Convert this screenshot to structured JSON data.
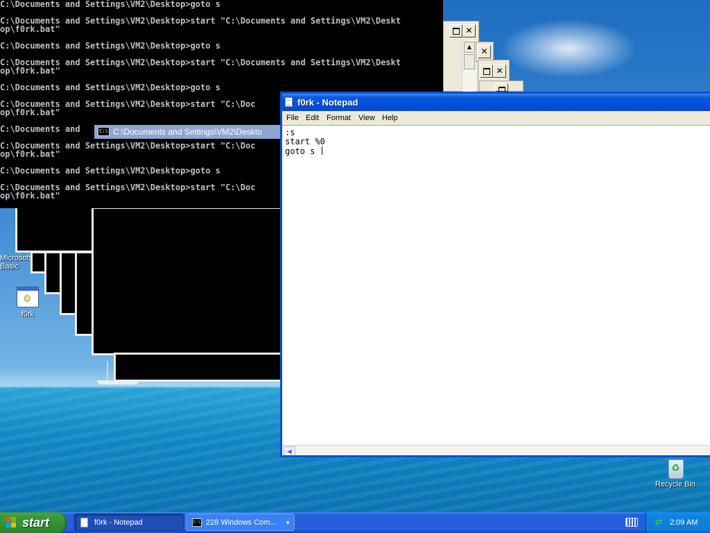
{
  "desktop": {
    "icons": [
      {
        "label": "Microsoft Basic"
      },
      {
        "label": "f0rk"
      },
      {
        "label": "Recycle Bin"
      }
    ]
  },
  "console": {
    "window_title": "C:\\Documents and Settings\\VM2\\Deskto",
    "lines": [
      "C:\\Documents and Settings\\VM2\\Desktop>goto s",
      "C:\\Documents and Settings\\VM2\\Desktop>start \"C:\\Documents and Settings\\VM2\\Deskt",
      "op\\f0rk.bat\"",
      "C:\\Documents and Settings\\VM2\\Desktop>goto s",
      "C:\\Documents and Settings\\VM2\\Desktop>start \"C:\\Documents and Settings\\VM2\\Deskt",
      "op\\f0rk.bat\"",
      "C:\\Documents and Settings\\VM2\\Desktop>goto s",
      "C:\\Documents and Settings\\VM2\\Desktop>start \"C:\\Doc",
      "op\\f0rk.bat\"",
      "C:\\Documents and",
      "C:\\Documents and Settings\\VM2\\Desktop>start \"C:\\Doc",
      "op\\f0rk.bat\"",
      "C:\\Documents and Settings\\VM2\\Desktop>goto s",
      "C:\\Documents and Settings\\VM2\\Desktop>start \"C:\\Doc",
      "op\\f0rk.bat\""
    ]
  },
  "notepad": {
    "title": "f0rk - Notepad",
    "menu": [
      "File",
      "Edit",
      "Format",
      "View",
      "Help"
    ],
    "text_lines": [
      ":s",
      "start %0",
      "goto s "
    ]
  },
  "taskbar": {
    "start_label": "start",
    "tasks": [
      {
        "label": "f0rk - Notepad"
      },
      {
        "label": "228 Windows Com..."
      }
    ],
    "clock": "2:09 AM"
  },
  "colors": {
    "xp_blue": "#245edb",
    "start_green": "#3a9a3a",
    "console_bg": "#000000",
    "console_text": "#c0c0c0"
  }
}
